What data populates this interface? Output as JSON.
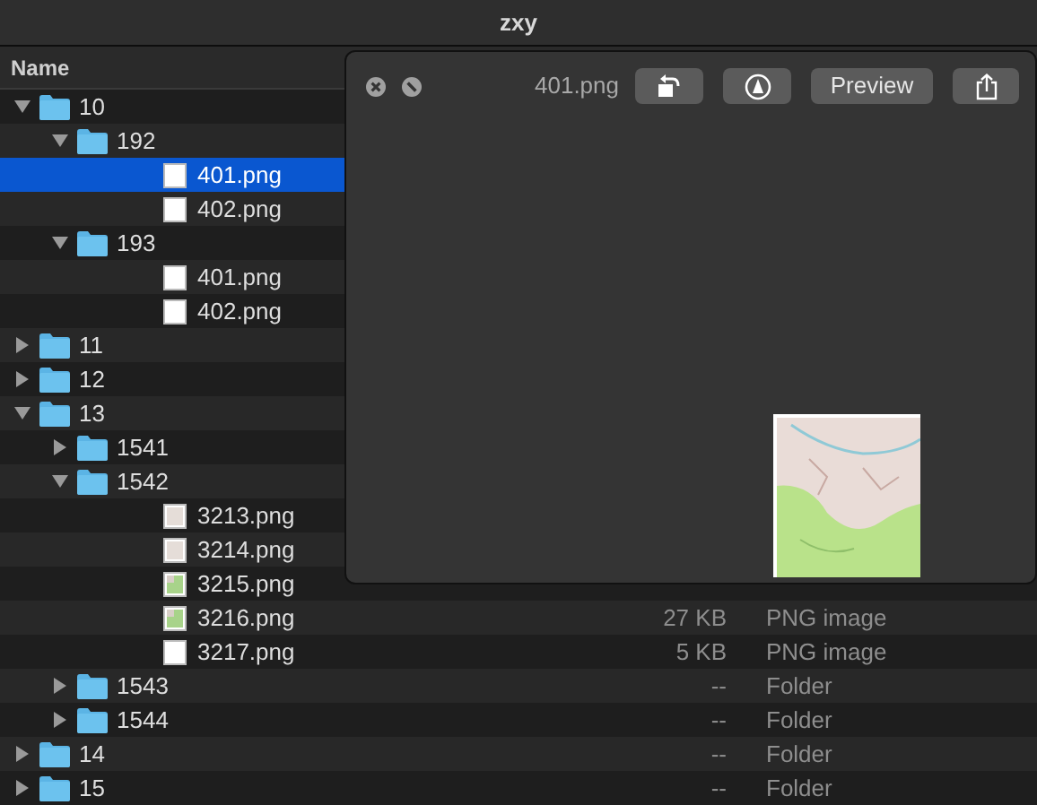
{
  "window": {
    "title": "zxy"
  },
  "column_header": {
    "label": "Name"
  },
  "tree": [
    {
      "name": "10",
      "kind": "folder",
      "expanded": true,
      "selected": false,
      "children": [
        {
          "name": "192",
          "kind": "folder",
          "expanded": true,
          "selected": false,
          "children": [
            {
              "name": "401.png",
              "kind": "plain",
              "selected": true
            },
            {
              "name": "402.png",
              "kind": "plain",
              "selected": false
            }
          ]
        },
        {
          "name": "193",
          "kind": "folder",
          "expanded": true,
          "selected": false,
          "children": [
            {
              "name": "401.png",
              "kind": "plain",
              "selected": false
            },
            {
              "name": "402.png",
              "kind": "plain",
              "selected": false
            }
          ]
        }
      ]
    },
    {
      "name": "11",
      "kind": "folder",
      "expanded": false,
      "selected": false
    },
    {
      "name": "12",
      "kind": "folder",
      "expanded": false,
      "selected": false
    },
    {
      "name": "13",
      "kind": "folder",
      "expanded": true,
      "selected": false,
      "children": [
        {
          "name": "1541",
          "kind": "folder",
          "expanded": false,
          "selected": false
        },
        {
          "name": "1542",
          "kind": "folder",
          "expanded": true,
          "selected": false,
          "children": [
            {
              "name": "3213.png",
              "kind": "map",
              "selected": false
            },
            {
              "name": "3214.png",
              "kind": "map",
              "selected": false
            },
            {
              "name": "3215.png",
              "kind": "meadow",
              "selected": false
            },
            {
              "name": "3216.png",
              "kind": "meadow",
              "selected": false,
              "size": "27 KB",
              "type": "PNG image"
            },
            {
              "name": "3217.png",
              "kind": "plain",
              "selected": false,
              "size": "5 KB",
              "type": "PNG image"
            }
          ]
        },
        {
          "name": "1543",
          "kind": "folder",
          "expanded": false,
          "selected": false,
          "size": "--",
          "type": "Folder"
        },
        {
          "name": "1544",
          "kind": "folder",
          "expanded": false,
          "selected": false,
          "size": "--",
          "type": "Folder"
        }
      ]
    },
    {
      "name": "14",
      "kind": "folder",
      "expanded": false,
      "selected": false,
      "size": "--",
      "type": "Folder"
    },
    {
      "name": "15",
      "kind": "folder",
      "expanded": false,
      "selected": false,
      "size": "--",
      "type": "Folder"
    }
  ],
  "quick_look": {
    "title": "401.png",
    "buttons": [
      {
        "kind": "rotate"
      },
      {
        "kind": "markup"
      },
      {
        "kind": "text",
        "label": "Preview"
      },
      {
        "kind": "share"
      }
    ]
  }
}
